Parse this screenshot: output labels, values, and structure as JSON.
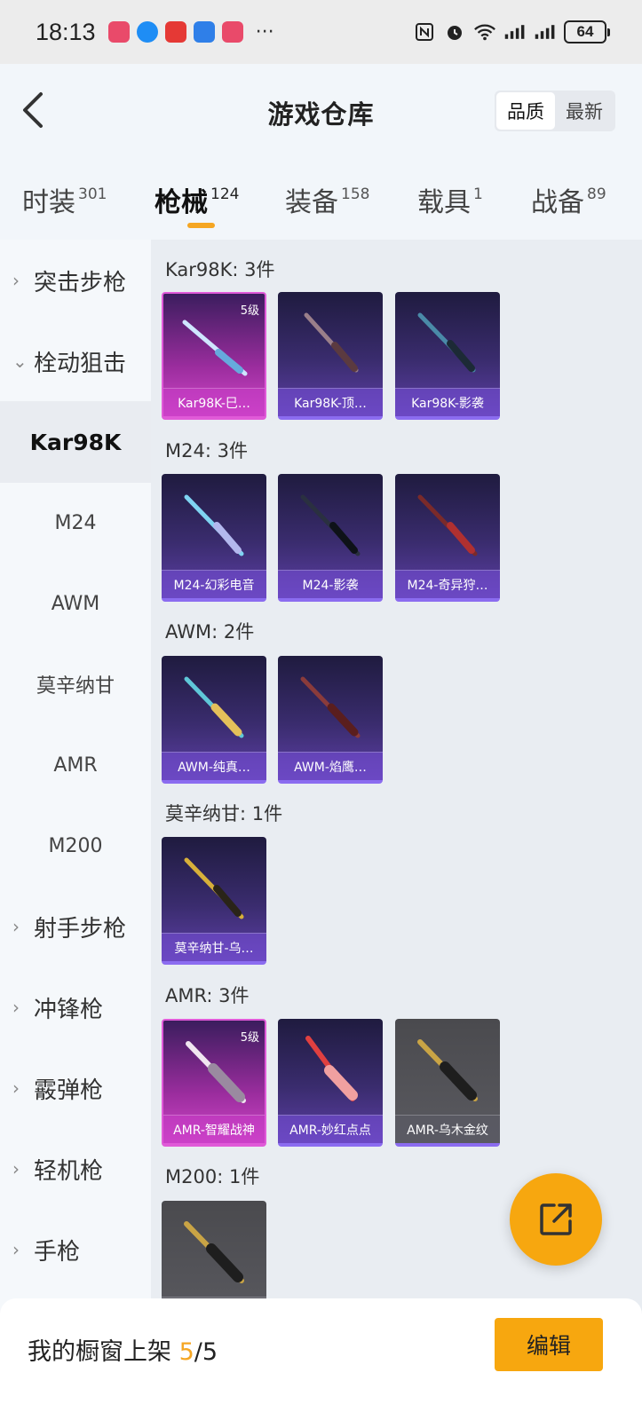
{
  "status_bar": {
    "time": "18:13",
    "battery": "64",
    "more": "···"
  },
  "header": {
    "title": "游戏仓库",
    "sort_options": [
      "品质",
      "最新"
    ]
  },
  "tabs": [
    {
      "label": "时装",
      "count": "301"
    },
    {
      "label": "枪械",
      "count": "124"
    },
    {
      "label": "装备",
      "count": "158"
    },
    {
      "label": "载具",
      "count": "1"
    },
    {
      "label": "战备",
      "count": "89"
    }
  ],
  "sidebar": {
    "items": [
      {
        "label": "突击步枪",
        "type": "group"
      },
      {
        "label": "栓动狙击",
        "type": "group"
      },
      {
        "label": "Kar98K",
        "type": "sub"
      },
      {
        "label": "M24",
        "type": "sub"
      },
      {
        "label": "AWM",
        "type": "sub"
      },
      {
        "label": "莫辛纳甘",
        "type": "sub"
      },
      {
        "label": "AMR",
        "type": "sub"
      },
      {
        "label": "M200",
        "type": "sub"
      },
      {
        "label": "射手步枪",
        "type": "group"
      },
      {
        "label": "冲锋枪",
        "type": "group"
      },
      {
        "label": "霰弹枪",
        "type": "group"
      },
      {
        "label": "轻机枪",
        "type": "group"
      },
      {
        "label": "手枪",
        "type": "group"
      }
    ]
  },
  "groups": [
    {
      "title": "Kar98K: 3件",
      "items": [
        {
          "name": "Kar98K-巳…",
          "level": "5级",
          "rarity": "pink"
        },
        {
          "name": "Kar98K-顶…",
          "rarity": "purple"
        },
        {
          "name": "Kar98K-影袭",
          "rarity": "purple"
        }
      ]
    },
    {
      "title": "M24: 3件",
      "items": [
        {
          "name": "M24-幻彩电音",
          "rarity": "purple"
        },
        {
          "name": "M24-影袭",
          "rarity": "purple"
        },
        {
          "name": "M24-奇异狩…",
          "rarity": "purple"
        }
      ]
    },
    {
      "title": "AWM: 2件",
      "items": [
        {
          "name": "AWM-纯真…",
          "rarity": "purple"
        },
        {
          "name": "AWM-焰鹰…",
          "rarity": "purple"
        }
      ]
    },
    {
      "title": "莫辛纳甘: 1件",
      "items": [
        {
          "name": "莫辛纳甘-乌…",
          "rarity": "purple"
        }
      ]
    },
    {
      "title": "AMR: 3件",
      "items": [
        {
          "name": "AMR-智耀战神",
          "level": "5级",
          "rarity": "pink"
        },
        {
          "name": "AMR-妙红点点",
          "rarity": "purple"
        },
        {
          "name": "AMR-乌木金纹",
          "rarity": "gray"
        }
      ]
    },
    {
      "title": "M200: 1件",
      "items": [
        {
          "name": "",
          "rarity": "gray"
        }
      ]
    }
  ],
  "bottom_bar": {
    "label": "我的橱窗上架",
    "count_current": "5",
    "count_total": "/5",
    "edit_label": "编辑"
  }
}
